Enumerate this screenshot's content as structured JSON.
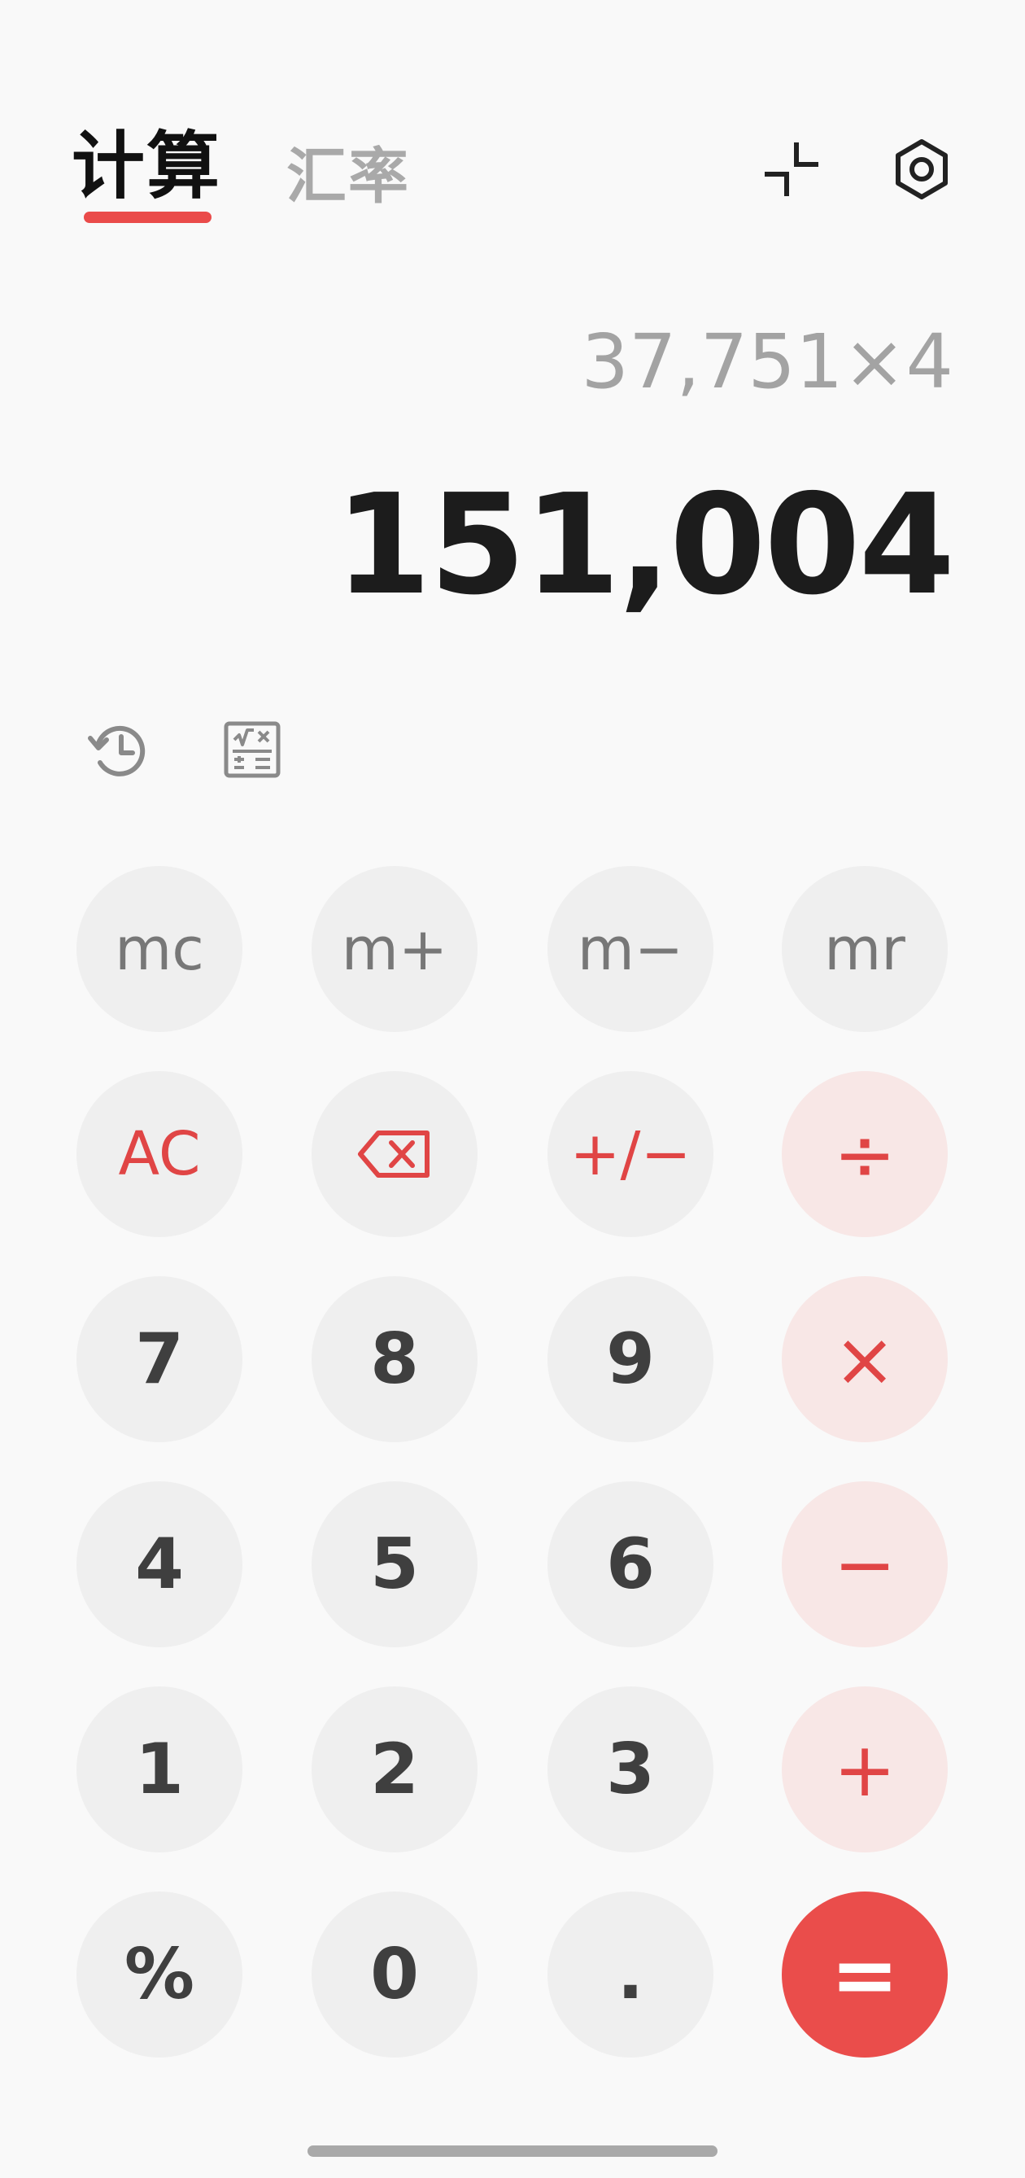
{
  "tabs": {
    "calculate": "计算",
    "exchange_rate": "汇率"
  },
  "icons": {
    "shrink": "shrink-icon",
    "settings": "settings-icon",
    "history": "history-icon",
    "scientific": "scientific-calculator-icon",
    "backspace": "backspace-icon"
  },
  "display": {
    "expression": "37,751×4",
    "result": "151,004"
  },
  "keys": {
    "mc": "mc",
    "m_plus": "m+",
    "m_minus": "m−",
    "mr": "mr",
    "ac": "AC",
    "plus_minus": "+/−",
    "divide": "÷",
    "seven": "7",
    "eight": "8",
    "nine": "9",
    "multiply": "×",
    "four": "4",
    "five": "5",
    "six": "6",
    "minus": "−",
    "one": "1",
    "two": "2",
    "three": "3",
    "plus": "+",
    "percent": "%",
    "zero": "0",
    "decimal": ".",
    "equals": "="
  },
  "colors": {
    "accent": "#ea4b4a",
    "operator_bg": "#f8e7e6",
    "key_bg": "#efefef",
    "background": "#f9f9f9"
  }
}
